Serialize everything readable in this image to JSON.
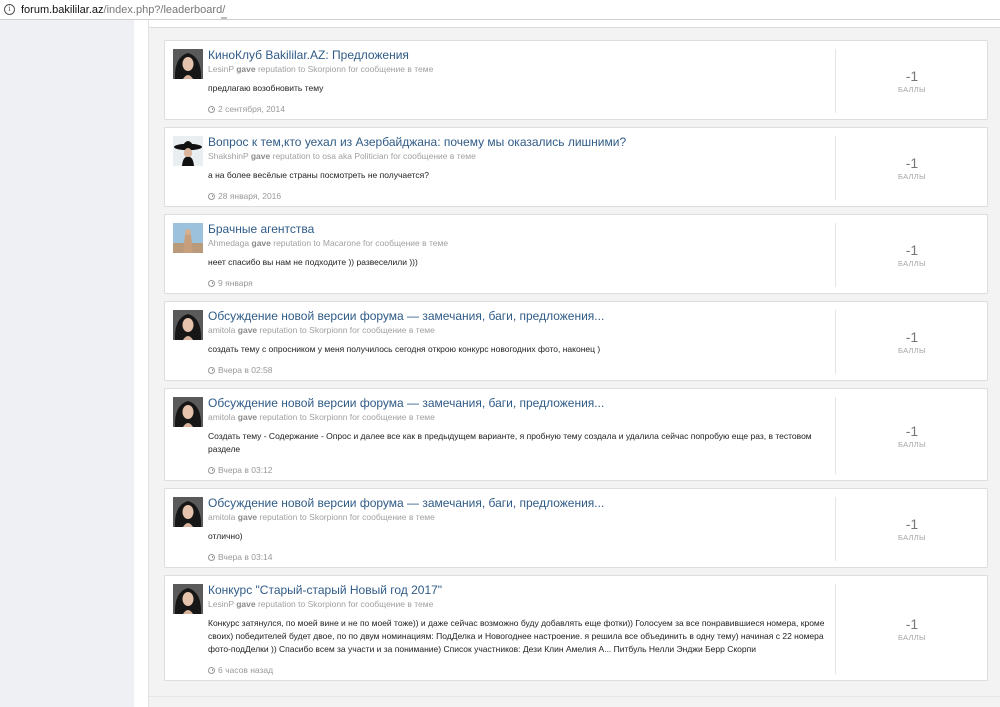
{
  "browser": {
    "url_host": "forum.bakililar.az",
    "url_path": "/index.php?/leaderboard/"
  },
  "items": [
    {
      "title": "КиноКлуб Bakililar.AZ: Предложения",
      "user": "LesinP",
      "gave": "gave",
      "target": "reputation to Skorpionn for сообщение в теме",
      "body": "предлагаю возобновить тему",
      "date": "2 сентября, 2014",
      "points": "-1",
      "points_label": "БАЛЛЫ",
      "avatar": "dark-hair-woman"
    },
    {
      "title": "Вопрос к тем,кто уехал из Азербайджана: почему мы оказались лишними?",
      "user": "ShakshinP",
      "gave": "gave",
      "target": "reputation to osa aka Politician for сообщение в теме",
      "body": "а на более весёлые страны посмотреть не получается?",
      "date": "28 января, 2016",
      "points": "-1",
      "points_label": "БАЛЛЫ",
      "avatar": "black-hat"
    },
    {
      "title": "Брачные агентства",
      "user": "Ahmedaga",
      "gave": "gave",
      "target": "reputation to Macarone for сообщение в теме",
      "body": "неет спасибо вы нам не подходите )) развеселили )))",
      "date": "9 января",
      "points": "-1",
      "points_label": "БАЛЛЫ",
      "avatar": "sky-figure"
    },
    {
      "title": "Обсуждение новой версии форума — замечания, баги, предложения...",
      "user": "amitola",
      "gave": "gave",
      "target": "reputation to Skorpionn for сообщение в теме",
      "body": "создать тему с опросником у меня получилось сегодня открою конкурс новогодних фото, наконец )",
      "date": "Вчера в 02:58",
      "points": "-1",
      "points_label": "БАЛЛЫ",
      "avatar": "dark-hair-woman"
    },
    {
      "title": "Обсуждение новой версии форума — замечания, баги, предложения...",
      "user": "amitola",
      "gave": "gave",
      "target": "reputation to Skorpionn for сообщение в теме",
      "body": "Создать тему - Содержание - Опрос и далее все как в предыдущем варианте, я пробную тему создала и удалила сейчас попробую еще раз, в тестовом разделе",
      "date": "Вчера в 03:12",
      "points": "-1",
      "points_label": "БАЛЛЫ",
      "avatar": "dark-hair-woman"
    },
    {
      "title": "Обсуждение новой версии форума — замечания, баги, предложения...",
      "user": "amitola",
      "gave": "gave",
      "target": "reputation to Skorpionn for сообщение в теме",
      "body": "отлично)",
      "date": "Вчера в 03:14",
      "points": "-1",
      "points_label": "БАЛЛЫ",
      "avatar": "dark-hair-woman"
    },
    {
      "title": "Конкурс \"Старый-старый Новый год 2017\"",
      "user": "LesinP",
      "gave": "gave",
      "target": "reputation to Skorpionn for сообщение в теме",
      "body": "Конкурс затянулся, по моей вине и не по моей тоже)) и даже сейчас возможно буду добавлять еще фотки)) Голосуем за все понравившиеся номера, кроме своих) победителей будет двое, по по двум номинациям: ПодДелка и Новогоднее настроение. я решила все объединить в одну тему) начиная с 22 номера фото-подДелки )) Спасибо всем за участи и за понимание) Список участников: Дези Клин Амелия А... Питбуль Нелли Энджи Берр Скорпи",
      "date": "6 часов назад",
      "points": "-1",
      "points_label": "БАЛЛЫ",
      "avatar": "dark-hair-woman"
    }
  ]
}
